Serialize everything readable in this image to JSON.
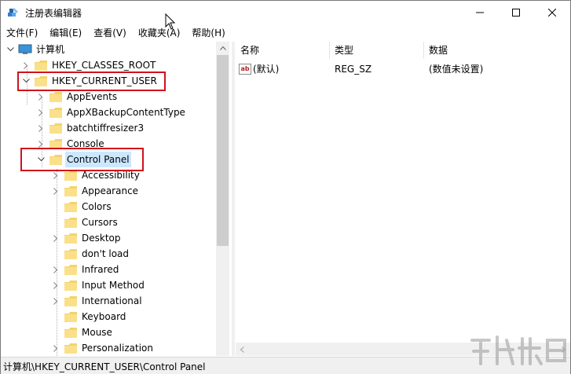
{
  "window": {
    "title": "注册表编辑器"
  },
  "menu": [
    "文件(F)",
    "编辑(E)",
    "查看(V)",
    "收藏夹(A)",
    "帮助(H)"
  ],
  "tree": {
    "root": "计算机",
    "hkcr": "HKEY_CLASSES_ROOT",
    "hkcu": "HKEY_CURRENT_USER",
    "hkcu_children": [
      "AppEvents",
      "AppXBackupContentType",
      "batchtiffresizer3",
      "Console"
    ],
    "control_panel": "Control Panel",
    "control_panel_children": [
      "Accessibility",
      "Appearance",
      "Colors",
      "Cursors",
      "Desktop",
      "don't load",
      "Infrared",
      "Input Method",
      "International",
      "Keyboard",
      "Mouse",
      "Personalization"
    ]
  },
  "list": {
    "columns": [
      "名称",
      "类型",
      "数据"
    ],
    "rows": [
      {
        "name": "(默认)",
        "type": "REG_SZ",
        "data": "(数值未设置)"
      }
    ]
  },
  "status": {
    "path": "计算机\\HKEY_CURRENT_USER\\Control Panel"
  },
  "colors": {
    "highlight": "#d0121b",
    "selection": "#cce8ff",
    "folder": "#f5d36b"
  },
  "icons": {
    "app": "registry-editor-icon",
    "folder": "folder-icon",
    "computer": "computer-icon",
    "value": "string-value-icon"
  }
}
